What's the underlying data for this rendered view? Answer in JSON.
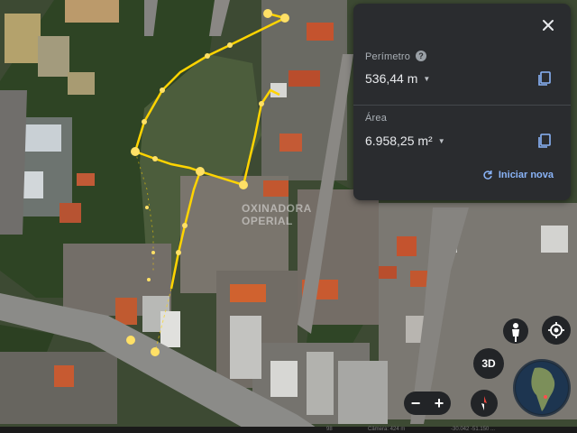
{
  "measure_panel": {
    "perimeter_label": "Perímetro",
    "perimeter_value": "536,44 m",
    "area_label": "Área",
    "area_value": "6.958,25 m²",
    "restart_label": "Iniciar nova",
    "help_glyph": "?",
    "close_icon": "close-icon",
    "copy_icon": "copy-icon"
  },
  "watermark": {
    "line1": "OXINADORA",
    "line2": "OPERIAL"
  },
  "map_controls": {
    "btn3d_label": "3D",
    "zoom_out": "−",
    "zoom_in": "+"
  },
  "footer": {
    "left": "98",
    "middle": "Câmera: 424 m",
    "right": "-30.042 -51.150 ..."
  },
  "colors": {
    "panel_bg": "#2a2c2f",
    "accent_blue": "#8ab4f8",
    "measure_line": "#ffd400"
  }
}
